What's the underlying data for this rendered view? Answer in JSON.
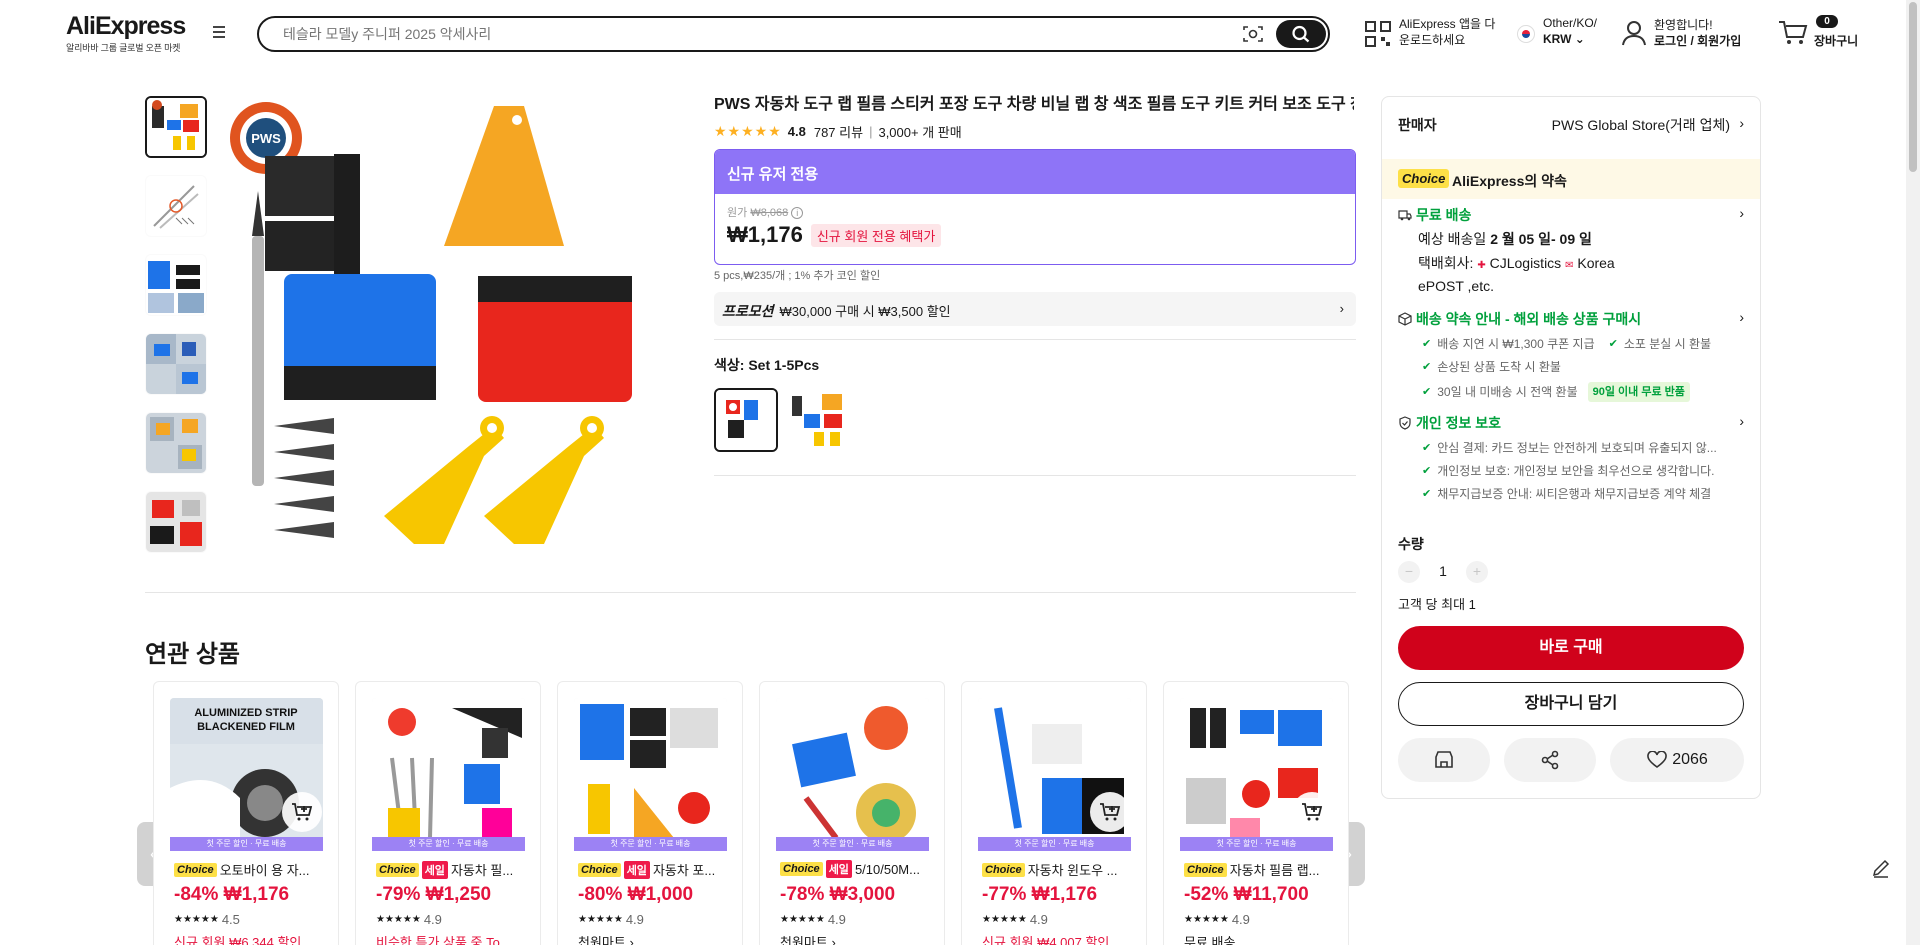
{
  "header": {
    "logo": "AliExpress",
    "logo_sub": "알리바바 그룹 글로벌 오픈 마켓",
    "search_placeholder": "테슬라 모델y 주니퍼 2025 악세사리",
    "app_line1": "AliExpress 앱을 다",
    "app_line2": "운로드하세요",
    "lang_line1": "Other/KO/",
    "lang_line2": "KRW",
    "user_line1": "환영합니다!",
    "user_line2": "로그인 / 회원가입",
    "cart_count": "0",
    "cart_label": "장바구니"
  },
  "product": {
    "title": "PWS 자동차 도구 랩 필름 스티커 포장 도구 차량 비닐 랩 창 색조 필름 도구 키트 커터 보조 도구 창 색조",
    "rating": "4.8",
    "reviews": "787 리뷰",
    "sold": "3,000+ 개 판매",
    "promo_header": "신규 유저 전용",
    "orig_label": "원가",
    "orig_price": "₩8,068",
    "price": "₩1,176",
    "price_tag": "신규 회원 전용 혜택가",
    "unit_line": "5 pcs,₩235/개 ; 1% 추가 코인 할인",
    "promo_label": "프로모션",
    "promo_text": "₩30,000 구매 시 ₩3,500 할인",
    "color_label": "색상:",
    "color_value": "Set 1-5Pcs"
  },
  "panel": {
    "seller_label": "판매자",
    "seller_name": "PWS Global Store(거래 업체)",
    "choice_badge": "Choice",
    "choice_title": "AliExpress의 약속",
    "shipping_title": "무료 배송",
    "delivery_prefix": "예상 배송일 ",
    "delivery_date": "2 월 05 일- 09 일",
    "carrier_prefix": "택배회사: ",
    "carrier_1": "CJLogistics",
    "carrier_2": "Korea",
    "carrier_3": "ePOST ,etc.",
    "promise_title": "배송 약속 안내 - 해외 배송 상품 구매시",
    "promise_1": "배송 지연 시 ₩1,300 쿠폰 지급",
    "promise_2": "소포 분실 시 환불",
    "promise_3": "손상된 상품 도착 시 환불",
    "promise_4": "30일 내 미배송 시 전액 환불",
    "promise_tag": "90일 이내 무료 반품",
    "privacy_title": "개인 정보 보호",
    "privacy_1": "안심 결제: 카드 정보는 안전하게 보호되며 유출되지 않...",
    "privacy_2": "개인정보 보호: 개인정보 보안을 최우선으로 생각합니다.",
    "privacy_3": "채무지급보증 안내: 씨티은행과 채무지급보증 계약 체결",
    "qty_label": "수량",
    "qty_value": "1",
    "qty_limit": "고객 당 최대 1",
    "buy_label": "바로 구매",
    "cart_label": "장바구니 담기",
    "wish_count": "2066"
  },
  "related": {
    "title": "연관 상품",
    "strip": "첫 주문 할인 · 무료 배송",
    "items": [
      {
        "tags": [
          "Choice"
        ],
        "title": "오토바이 용 자...",
        "price": "-84% ₩1,176",
        "rating": "4.5",
        "foot": "신규 회원 ₩6,344 할인"
      },
      {
        "tags": [
          "Choice",
          "세일"
        ],
        "title": "자동차 필...",
        "price": "-79% ₩1,250",
        "rating": "4.9",
        "foot": "비슷한 특가 상품 중 To"
      },
      {
        "tags": [
          "Choice",
          "세일"
        ],
        "title": "자동차 포...",
        "price": "-80% ₩1,000",
        "rating": "4.9",
        "foot": "천원마트 ›"
      },
      {
        "tags": [
          "Choice",
          "세일"
        ],
        "title": "5/10/50M...",
        "price": "-78% ₩3,000",
        "rating": "4.9",
        "foot": "천원마트 ›"
      },
      {
        "tags": [
          "Choice"
        ],
        "title": "자동차 윈도우 ...",
        "price": "-77% ₩1,176",
        "rating": "4.9",
        "foot": "신규 회원 ₩4,007 할인"
      },
      {
        "tags": [
          "Choice"
        ],
        "title": "자동차 필름 랩...",
        "price": "-52% ₩11,700",
        "rating": "4.9",
        "foot": "무료 배송"
      }
    ]
  },
  "colors": {
    "accent_red": "#d0021b",
    "promo_purple": "#8e74f7",
    "choice_yellow": "#fde047",
    "green": "#00a03c"
  }
}
